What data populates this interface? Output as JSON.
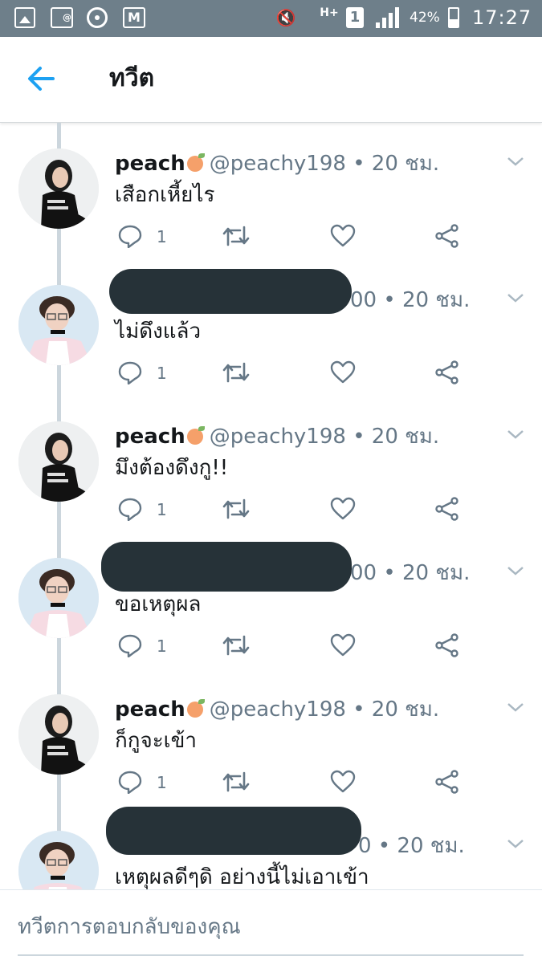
{
  "status_bar": {
    "network": "H+",
    "sim": "1",
    "battery": "42%",
    "time": "17:27",
    "icons": [
      "gallery-icon",
      "image-mention-icon",
      "disc-icon",
      "gmail-icon",
      "mute-icon",
      "signal-icon",
      "battery-icon"
    ]
  },
  "header": {
    "title": "ทวีต",
    "back_icon": "back-arrow-icon"
  },
  "tweets": [
    {
      "name": "peach",
      "emoji": "peach-emoji",
      "handle_time": "@peachy198 • 20 ชม.",
      "text": "เสือกเหี้ยไร",
      "reply_count": "1",
      "redacted": false
    },
    {
      "name": "",
      "handle_time": "00 • 20 ชม.",
      "text": "ไม่ดึงแล้ว",
      "reply_count": "1",
      "redacted": true
    },
    {
      "name": "peach",
      "emoji": "peach-emoji",
      "handle_time": "@peachy198 • 20 ชม.",
      "text": "มึงต้องดึงกู!!",
      "reply_count": "1",
      "redacted": false
    },
    {
      "name": "",
      "handle_time": "00 • 20 ชม.",
      "text": "ขอเหตุผล",
      "reply_count": "1",
      "redacted": true
    },
    {
      "name": "peach",
      "emoji": "peach-emoji",
      "handle_time": "@peachy198 • 20 ชม.",
      "text": "ก็กูจะเข้า",
      "reply_count": "1",
      "redacted": false
    },
    {
      "name": "",
      "handle_time": "0 • 20 ชม.",
      "text": "เหตุผลดีๆดิ อย่างนี้ไม่เอาเข้า",
      "reply_count": "",
      "redacted": true
    }
  ],
  "reply_bar": {
    "placeholder": "ทวีตการตอบกลับของคุณ"
  },
  "colors": {
    "accent": "#1da1f2",
    "status_bar": "#6e7f8a",
    "muted": "#657786",
    "redaction": "#263238"
  }
}
